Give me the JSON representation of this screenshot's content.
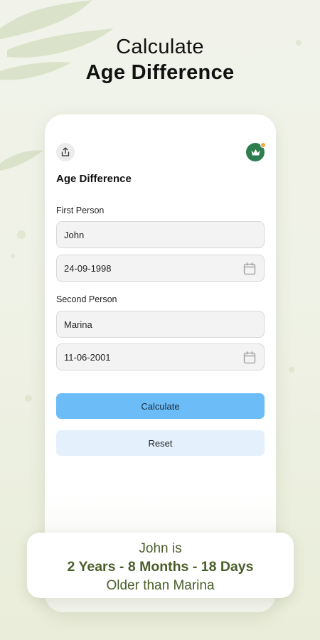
{
  "headline": {
    "line1": "Calculate",
    "line2": "Age Difference"
  },
  "app": {
    "title": "Age Difference"
  },
  "icons": {
    "share": "share-icon",
    "premium": "crown-icon",
    "calendar": "calendar-icon"
  },
  "first_person": {
    "label": "First Person",
    "name": "John",
    "date": "24-09-1998"
  },
  "second_person": {
    "label": "Second Person",
    "name": "Marina",
    "date": "11-06-2001"
  },
  "buttons": {
    "calculate": "Calculate",
    "reset": "Reset"
  },
  "result": {
    "line1": "John is",
    "line2": "2 Years - 8 Months - 18 Days",
    "line3": "Older than Marina"
  },
  "colors": {
    "primary_button": "#6bbcf7",
    "secondary_button": "#e4f0fc",
    "premium_badge": "#2e7d4f",
    "result_text": "#4a5e2a"
  }
}
